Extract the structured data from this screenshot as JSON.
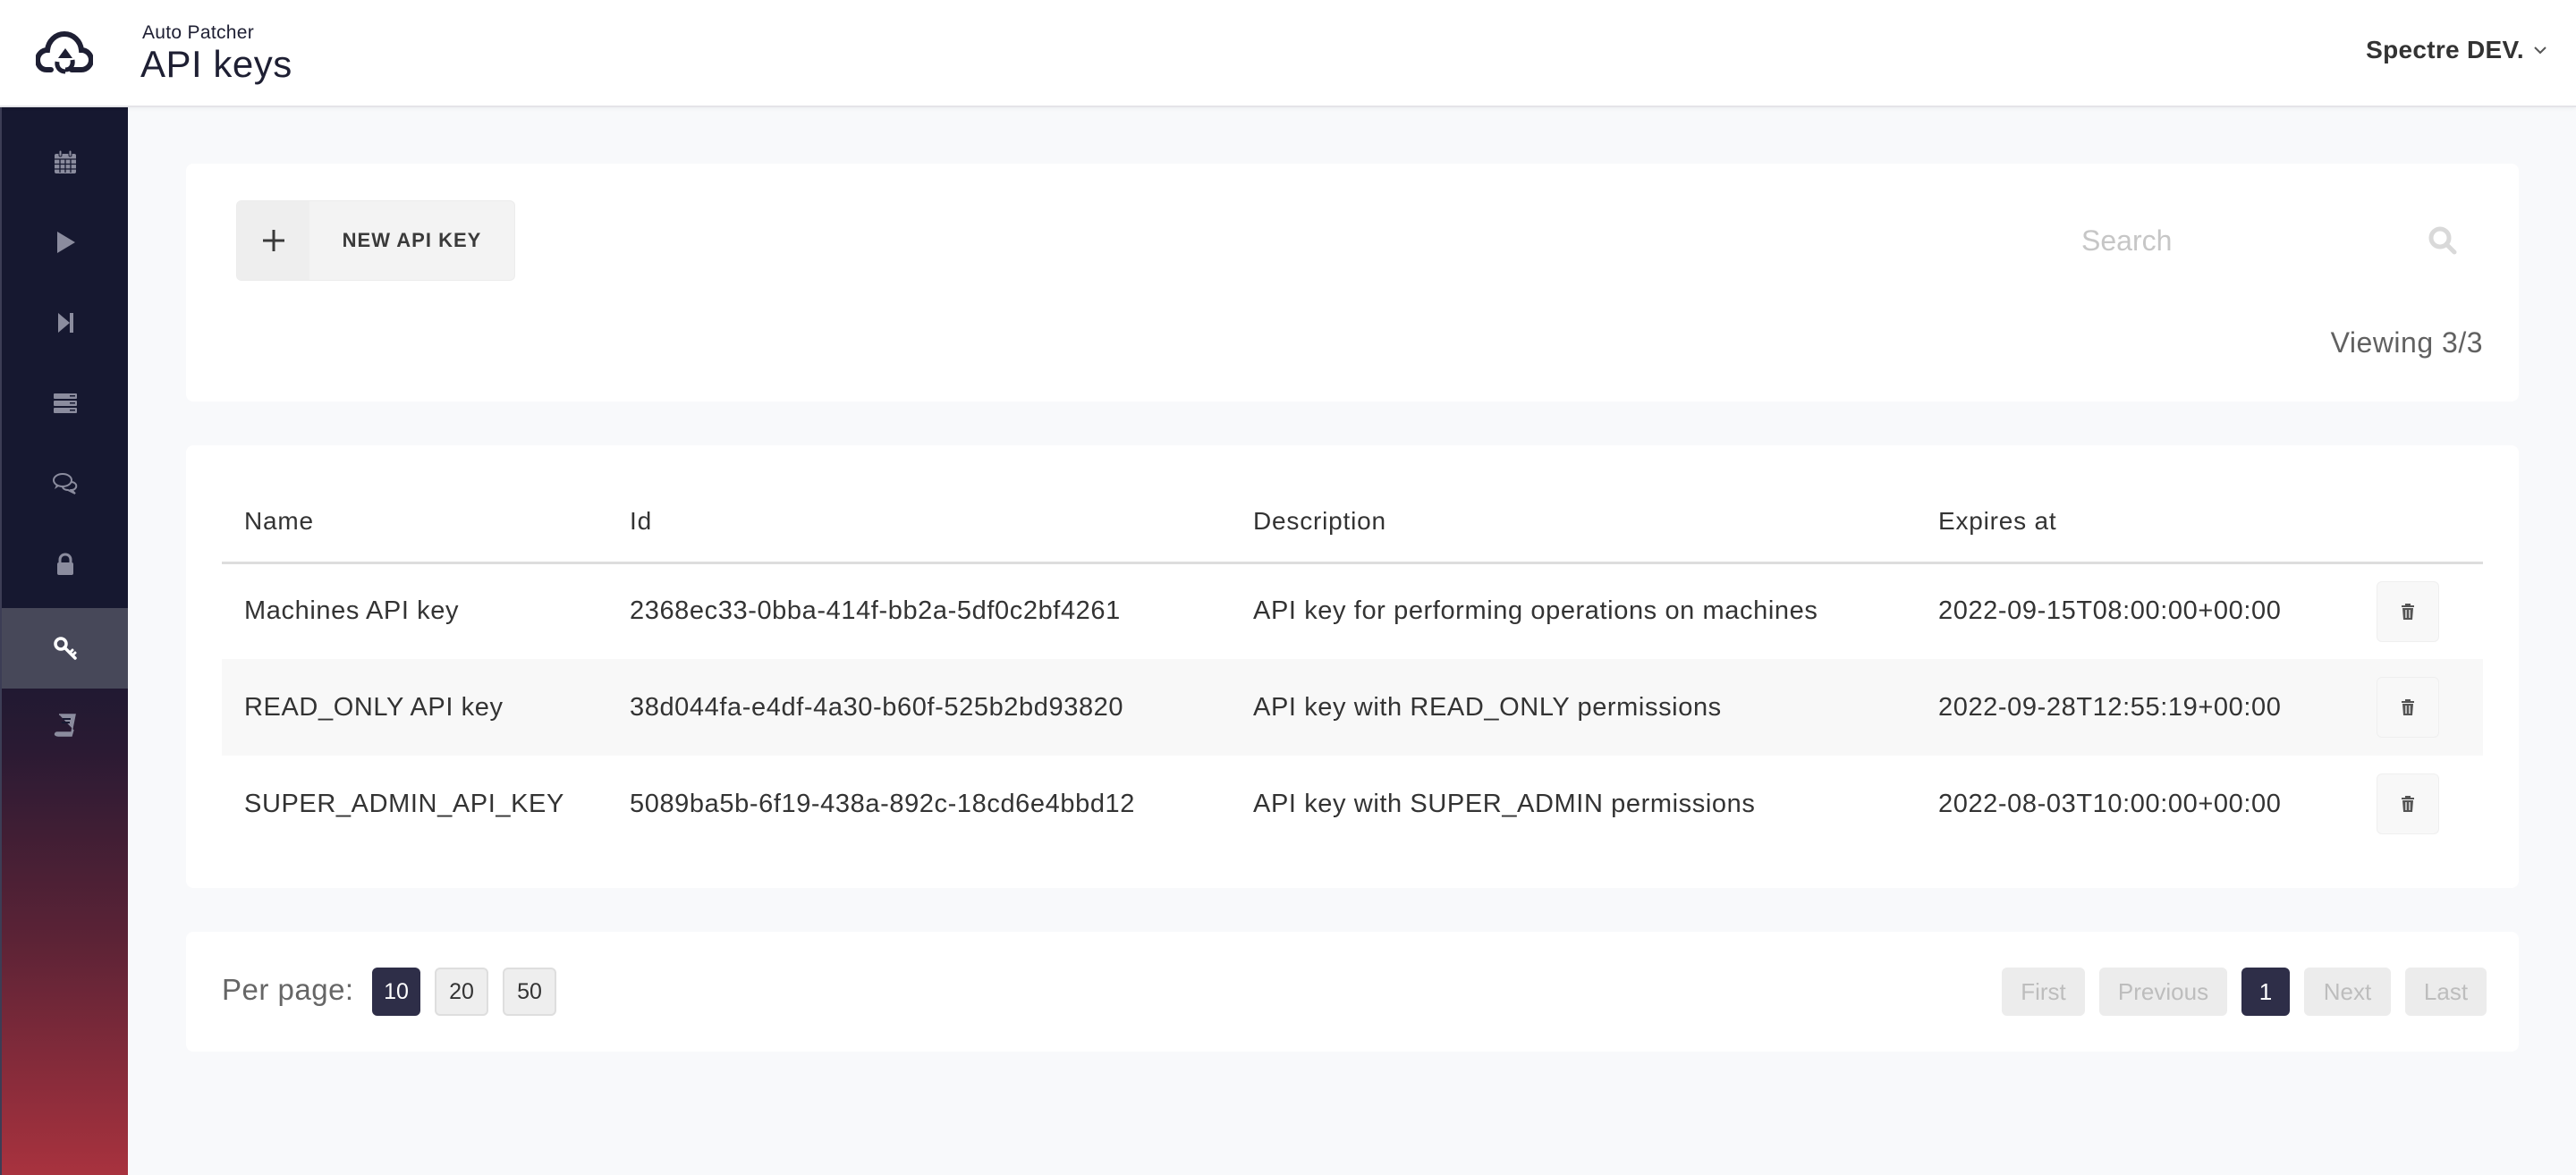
{
  "header": {
    "app_name": "Auto Patcher",
    "page_title": "API keys",
    "org_name": "Spectre DEV.",
    "logo_icon": "cloud-upload-icon"
  },
  "sidebar": {
    "items": [
      {
        "icon": "calendar-icon",
        "active": false
      },
      {
        "icon": "play-icon",
        "active": false
      },
      {
        "icon": "step-forward-icon",
        "active": false
      },
      {
        "icon": "server-icon",
        "active": false
      },
      {
        "icon": "comments-icon",
        "active": false
      },
      {
        "icon": "lock-icon",
        "active": false
      },
      {
        "icon": "key-icon",
        "active": true
      },
      {
        "icon": "book-icon",
        "active": false
      }
    ]
  },
  "toolbar": {
    "new_button_label": "NEW API KEY",
    "search_placeholder": "Search",
    "search_value": "",
    "viewing_text": "Viewing 3/3"
  },
  "table": {
    "columns": [
      "Name",
      "Id",
      "Description",
      "Expires at"
    ],
    "rows": [
      {
        "name": "Machines API key",
        "id": "2368ec33-0bba-414f-bb2a-5df0c2bf4261",
        "description": "API key for performing operations on machines",
        "expires_at": "2022-09-15T08:00:00+00:00"
      },
      {
        "name": "READ_ONLY API key",
        "id": "38d044fa-e4df-4a30-b60f-525b2bd93820",
        "description": "API key with READ_ONLY permissions",
        "expires_at": "2022-09-28T12:55:19+00:00"
      },
      {
        "name": "SUPER_ADMIN_API_KEY",
        "id": "5089ba5b-6f19-438a-892c-18cd6e4bbd12",
        "description": "API key with SUPER_ADMIN permissions",
        "expires_at": "2022-08-03T10:00:00+00:00"
      }
    ]
  },
  "pagination": {
    "per_page_label": "Per page:",
    "per_page_options": [
      "10",
      "20",
      "50"
    ],
    "per_page_selected": "10",
    "first_label": "First",
    "previous_label": "Previous",
    "current_page": "1",
    "next_label": "Next",
    "last_label": "Last"
  },
  "colors": {
    "sidebar_top": "#161830",
    "sidebar_bottom": "#a8323e",
    "accent_dark": "#2e2e48",
    "page_background": "#f8f9fb"
  }
}
